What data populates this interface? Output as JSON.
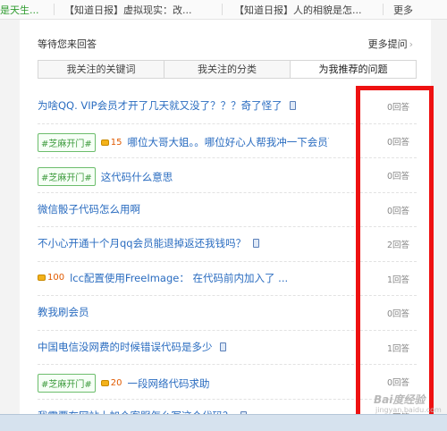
{
  "topbar": {
    "items": [
      "是天生...",
      "【知道日报】虚拟现实：改...",
      "【知道日报】人的相貌是怎...",
      "更多"
    ]
  },
  "panel": {
    "title": "等待您来回答",
    "more": "更多提问",
    "more_arrow": "›"
  },
  "tabs": [
    "我关注的关键词",
    "我关注的分类",
    "为我推荐的问题"
  ],
  "questions": [
    {
      "title": "为啥QQ. VIP会员才开了几天就又没了？？？奇了怪了",
      "answers": "0回答"
    },
    {
      "tag": "#芝麻开门#",
      "coins": "15",
      "title": "哪位大哥大姐。。哪位好心人帮我冲一下会员可",
      "answers": "0回答"
    },
    {
      "tag": "#芝麻开门#",
      "title": "这代码什么意思",
      "answers": "0回答"
    },
    {
      "title": "微信骰子代码怎么用啊",
      "answers": "0回答"
    },
    {
      "title": "不小心开通十个月qq会员能退掉返还我钱吗？",
      "answers": "2回答"
    },
    {
      "coins": "100",
      "title": "lcc配置使用FreeImage： 在代码前内加入了 ...",
      "answers": "1回答"
    },
    {
      "title": "教我刷会员",
      "answers": "0回答"
    },
    {
      "title": "中国电信没网费的时候错误代码是多少",
      "answers": "1回答"
    },
    {
      "tag": "#芝麻开门#",
      "coins": "20",
      "title": "一段网络代码求助",
      "answers": "0回答"
    },
    {
      "title": "我需要在网站上加个客服怎么写这个代码？",
      "answers": "0回答"
    }
  ],
  "watermark": {
    "logo": "Bai度经验",
    "url": "jingyan.baidu.com"
  },
  "colors": {
    "highlight": "#ee1111",
    "link": "#2a6cc0",
    "tag": "#3c9a3c"
  }
}
